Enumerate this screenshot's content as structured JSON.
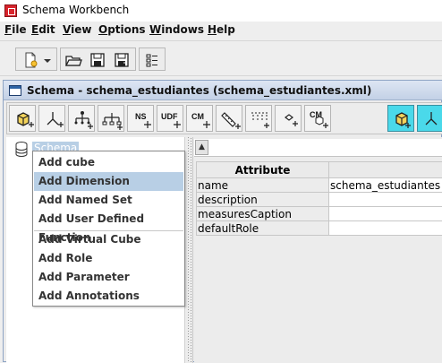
{
  "window": {
    "title": "Schema Workbench"
  },
  "menubar": {
    "items": [
      {
        "label": "File",
        "mnemonic": "F",
        "rest": "ile"
      },
      {
        "label": "Edit",
        "mnemonic": "E",
        "rest": "dit"
      },
      {
        "label": "View",
        "mnemonic": "V",
        "rest": "iew"
      },
      {
        "label": "Options",
        "mnemonic": "O",
        "rest": "ptions"
      },
      {
        "label": "Windows",
        "mnemonic": "W",
        "rest": "indows"
      },
      {
        "label": "Help",
        "mnemonic": "H",
        "rest": "elp"
      }
    ]
  },
  "main_toolbar": {
    "buttons": [
      {
        "icon": "new-file-icon"
      },
      {
        "icon": "dropdown-arrow-icon"
      },
      {
        "icon": "open-folder-icon"
      },
      {
        "icon": "save-icon"
      },
      {
        "icon": "save-as-icon"
      },
      {
        "icon": "preferences-icon"
      }
    ]
  },
  "schema_frame": {
    "title": "Schema - schema_estudiantes (schema_estudiantes.xml)",
    "toolbar": {
      "buttons": [
        {
          "icon": "add-cube-icon",
          "text": ""
        },
        {
          "icon": "add-dimension-icon",
          "text": ""
        },
        {
          "icon": "add-hierarchy-icon",
          "text": ""
        },
        {
          "icon": "add-level-icon",
          "text": ""
        },
        {
          "icon": "add-named-set-icon",
          "text": "NS"
        },
        {
          "icon": "add-udf-icon",
          "text": "UDF"
        },
        {
          "icon": "add-calculated-member-icon",
          "text": "CM"
        },
        {
          "icon": "add-measure-icon",
          "text": ""
        },
        {
          "icon": "add-property-icon",
          "text": ""
        },
        {
          "icon": "add-closure-icon",
          "text": ""
        },
        {
          "icon": "add-cube-measure-icon",
          "text": "CM"
        },
        {
          "icon": "add-virtual-cube-icon",
          "text": ""
        },
        {
          "icon": "add-virtual-dimension-icon",
          "text": ""
        }
      ]
    },
    "tree": {
      "root_label": "Schema"
    },
    "properties": {
      "header": "Attribute",
      "rows": [
        {
          "name": "name",
          "value": "schema_estudiantes"
        },
        {
          "name": "description",
          "value": ""
        },
        {
          "name": "measuresCaption",
          "value": ""
        },
        {
          "name": "defaultRole",
          "value": ""
        }
      ]
    }
  },
  "context_menu": {
    "items": [
      {
        "label": "Add cube",
        "highlighted": false
      },
      {
        "label": "Add Dimension",
        "highlighted": true
      },
      {
        "label": "Add Named Set",
        "highlighted": false
      },
      {
        "label": "Add User Defined Function",
        "highlighted": false
      },
      {
        "label": "Add Virtual Cube",
        "highlighted": false
      },
      {
        "label": "Add Role",
        "highlighted": false
      },
      {
        "label": "Add Parameter",
        "highlighted": false
      },
      {
        "label": "Add Annotations",
        "highlighted": false
      }
    ]
  }
}
